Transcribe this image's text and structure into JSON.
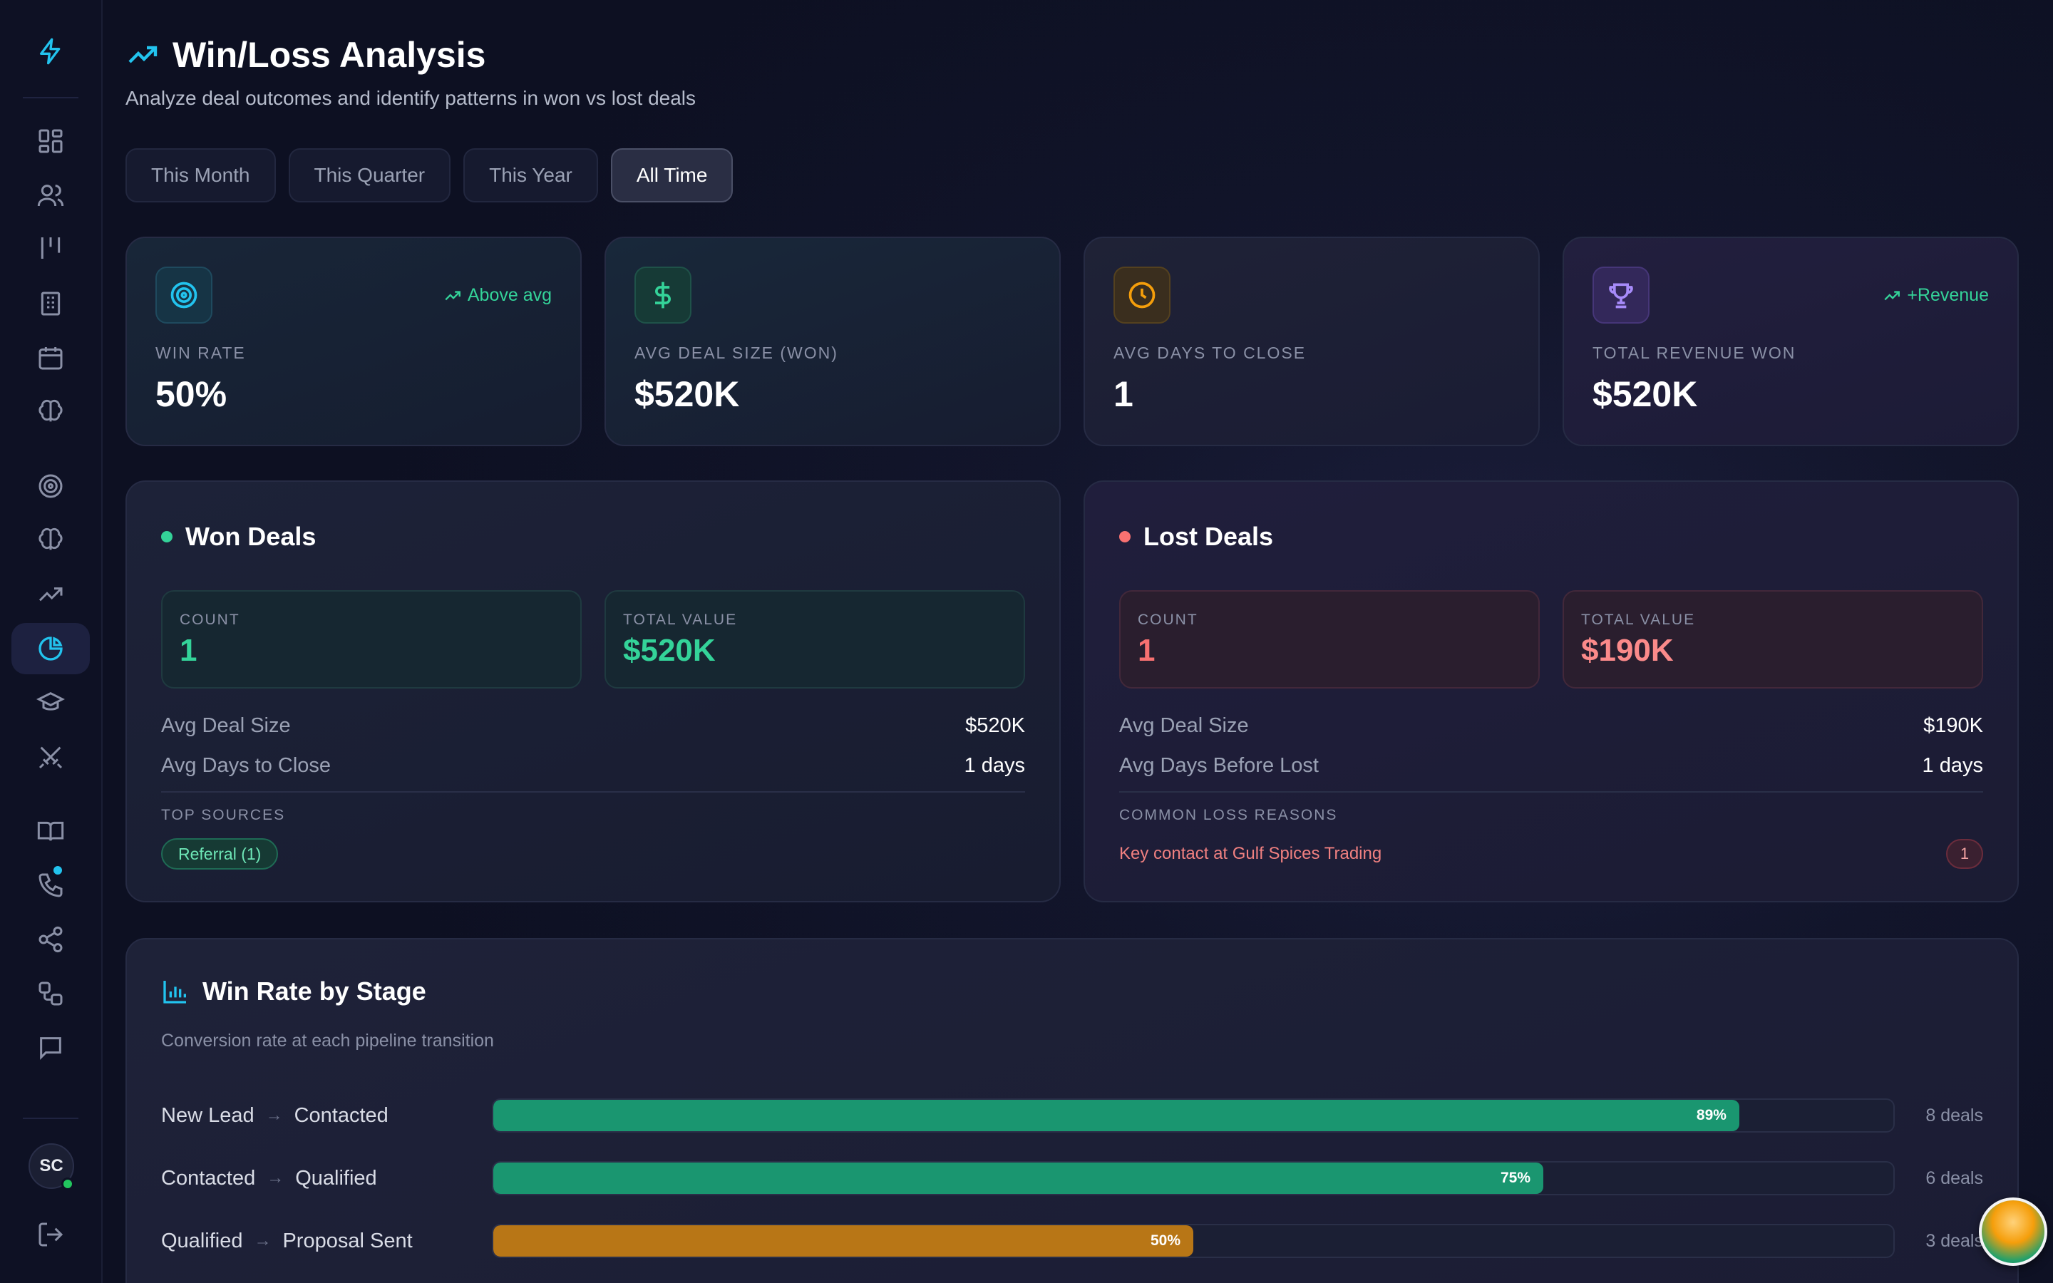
{
  "header": {
    "title": "Win/Loss Analysis",
    "subtitle": "Analyze deal outcomes and identify patterns in won vs lost deals"
  },
  "tabs": [
    {
      "label": "This Month",
      "active": false
    },
    {
      "label": "This Quarter",
      "active": false
    },
    {
      "label": "This Year",
      "active": false
    },
    {
      "label": "All Time",
      "active": true
    }
  ],
  "kpis": [
    {
      "label": "WIN RATE",
      "value": "50%",
      "trend": "Above avg",
      "icon": "target-icon"
    },
    {
      "label": "AVG DEAL SIZE (WON)",
      "value": "$520K",
      "trend": "",
      "icon": "dollar-icon"
    },
    {
      "label": "AVG DAYS TO CLOSE",
      "value": "1",
      "trend": "",
      "icon": "clock-icon"
    },
    {
      "label": "TOTAL REVENUE WON",
      "value": "$520K",
      "trend": "+Revenue",
      "icon": "trophy-icon"
    }
  ],
  "won": {
    "title": "Won Deals",
    "count_label": "COUNT",
    "count": "1",
    "total_label": "TOTAL VALUE",
    "total": "$520K",
    "avg_size_label": "Avg Deal Size",
    "avg_size": "$520K",
    "avg_days_label": "Avg Days to Close",
    "avg_days": "1 days",
    "sources_label": "TOP SOURCES",
    "sources": [
      "Referral (1)"
    ]
  },
  "lost": {
    "title": "Lost Deals",
    "count_label": "COUNT",
    "count": "1",
    "total_label": "TOTAL VALUE",
    "total": "$190K",
    "avg_size_label": "Avg Deal Size",
    "avg_size": "$190K",
    "avg_days_label": "Avg Days Before Lost",
    "avg_days": "1 days",
    "reasons_label": "COMMON LOSS REASONS",
    "reasons": [
      {
        "text": "Key contact at Gulf Spices Trading",
        "count": "1"
      }
    ]
  },
  "stages": {
    "title": "Win Rate by Stage",
    "subtitle": "Conversion rate at each pipeline transition",
    "rows": [
      {
        "from": "New Lead",
        "to": "Contacted",
        "rate": 89,
        "rate_label": "89%",
        "deals": "8 deals",
        "color": "#1a9670"
      },
      {
        "from": "Contacted",
        "to": "Qualified",
        "rate": 75,
        "rate_label": "75%",
        "deals": "6 deals",
        "color": "#1a9670"
      },
      {
        "from": "Qualified",
        "to": "Proposal Sent",
        "rate": 50,
        "rate_label": "50%",
        "deals": "3 deals",
        "color": "#b87616"
      }
    ]
  },
  "user": {
    "initials": "SC"
  },
  "colors": {
    "accent": "#22c3ee",
    "won": "#34d399",
    "lost": "#f87171",
    "warning": "#f59e0b",
    "purple": "#a78bfa"
  }
}
